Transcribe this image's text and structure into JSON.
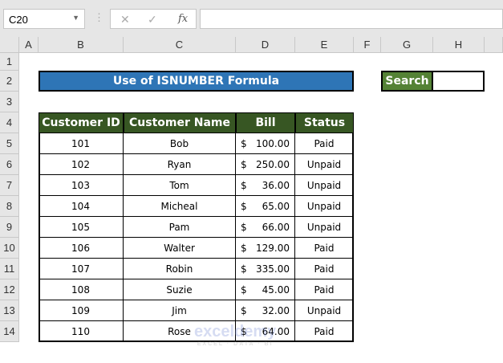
{
  "formula_bar": {
    "name_box": "C20",
    "cancel_icon": "✕",
    "enter_icon": "✓",
    "fx_label": "fx",
    "formula": ""
  },
  "columns": [
    "A",
    "B",
    "C",
    "D",
    "E",
    "F",
    "G",
    "H"
  ],
  "rows": [
    "1",
    "2",
    "3",
    "4",
    "5",
    "6",
    "7",
    "8",
    "9",
    "10",
    "11",
    "12",
    "13",
    "14"
  ],
  "title": "Use of ISNUMBER Formula",
  "search": {
    "label": "Search",
    "value": ""
  },
  "table": {
    "headers": [
      "Customer ID",
      "Customer Name",
      "Bill",
      "Status"
    ],
    "currency": "$",
    "rows": [
      [
        "101",
        "Bob",
        "100.00",
        "Paid"
      ],
      [
        "102",
        "Ryan",
        "250.00",
        "Unpaid"
      ],
      [
        "103",
        "Tom",
        "36.00",
        "Unpaid"
      ],
      [
        "104",
        "Micheal",
        "65.00",
        "Unpaid"
      ],
      [
        "105",
        "Pam",
        "66.00",
        "Unpaid"
      ],
      [
        "106",
        "Walter",
        "129.00",
        "Paid"
      ],
      [
        "107",
        "Robin",
        "335.00",
        "Paid"
      ],
      [
        "108",
        "Suzie",
        "45.00",
        "Paid"
      ],
      [
        "109",
        "Jim",
        "32.00",
        "Unpaid"
      ],
      [
        "110",
        "Rose",
        "64.00",
        "Paid"
      ]
    ]
  },
  "watermark": {
    "brand": "exceldemy",
    "tagline": "EXCEL · DATA · BI"
  },
  "colors": {
    "title_bg": "#2e75b6",
    "header_bg": "#375623",
    "search_bg": "#548235"
  }
}
